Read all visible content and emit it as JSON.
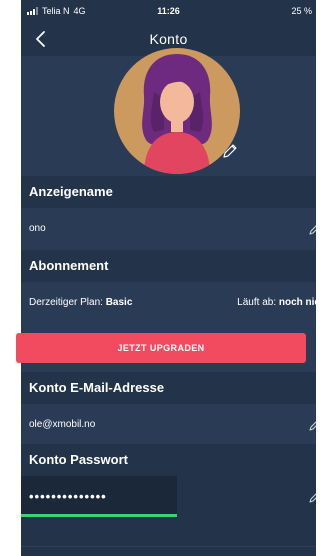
{
  "status_bar": {
    "carrier": "Telia N",
    "network": "4G",
    "time": "11:26",
    "battery": "25 %"
  },
  "nav": {
    "title": "Konto"
  },
  "sections": {
    "display_name": {
      "title": "Anzeigename",
      "value": "ono"
    },
    "subscription": {
      "title": "Abonnement",
      "plan_label": "Derzeitiger Plan:",
      "plan_value": "Basic",
      "expires_label": "Läuft ab:",
      "expires_value": "noch nie",
      "upgrade_button": "JETZT UPGRADEN"
    },
    "email": {
      "title": "Konto E-Mail-Adresse",
      "value": "ole@xmobil.no"
    },
    "password": {
      "title": "Konto Passwort",
      "value": "••••••••••••••",
      "strength": 1.0
    }
  },
  "colors": {
    "background": "#22334a",
    "row": "#2a3c55",
    "accent_button": "#f24a5f",
    "strength_bar": "#3fd07a"
  },
  "icons": {
    "back": "chevron-left-icon",
    "edit": "pencil-icon",
    "avatar": "user-avatar"
  }
}
